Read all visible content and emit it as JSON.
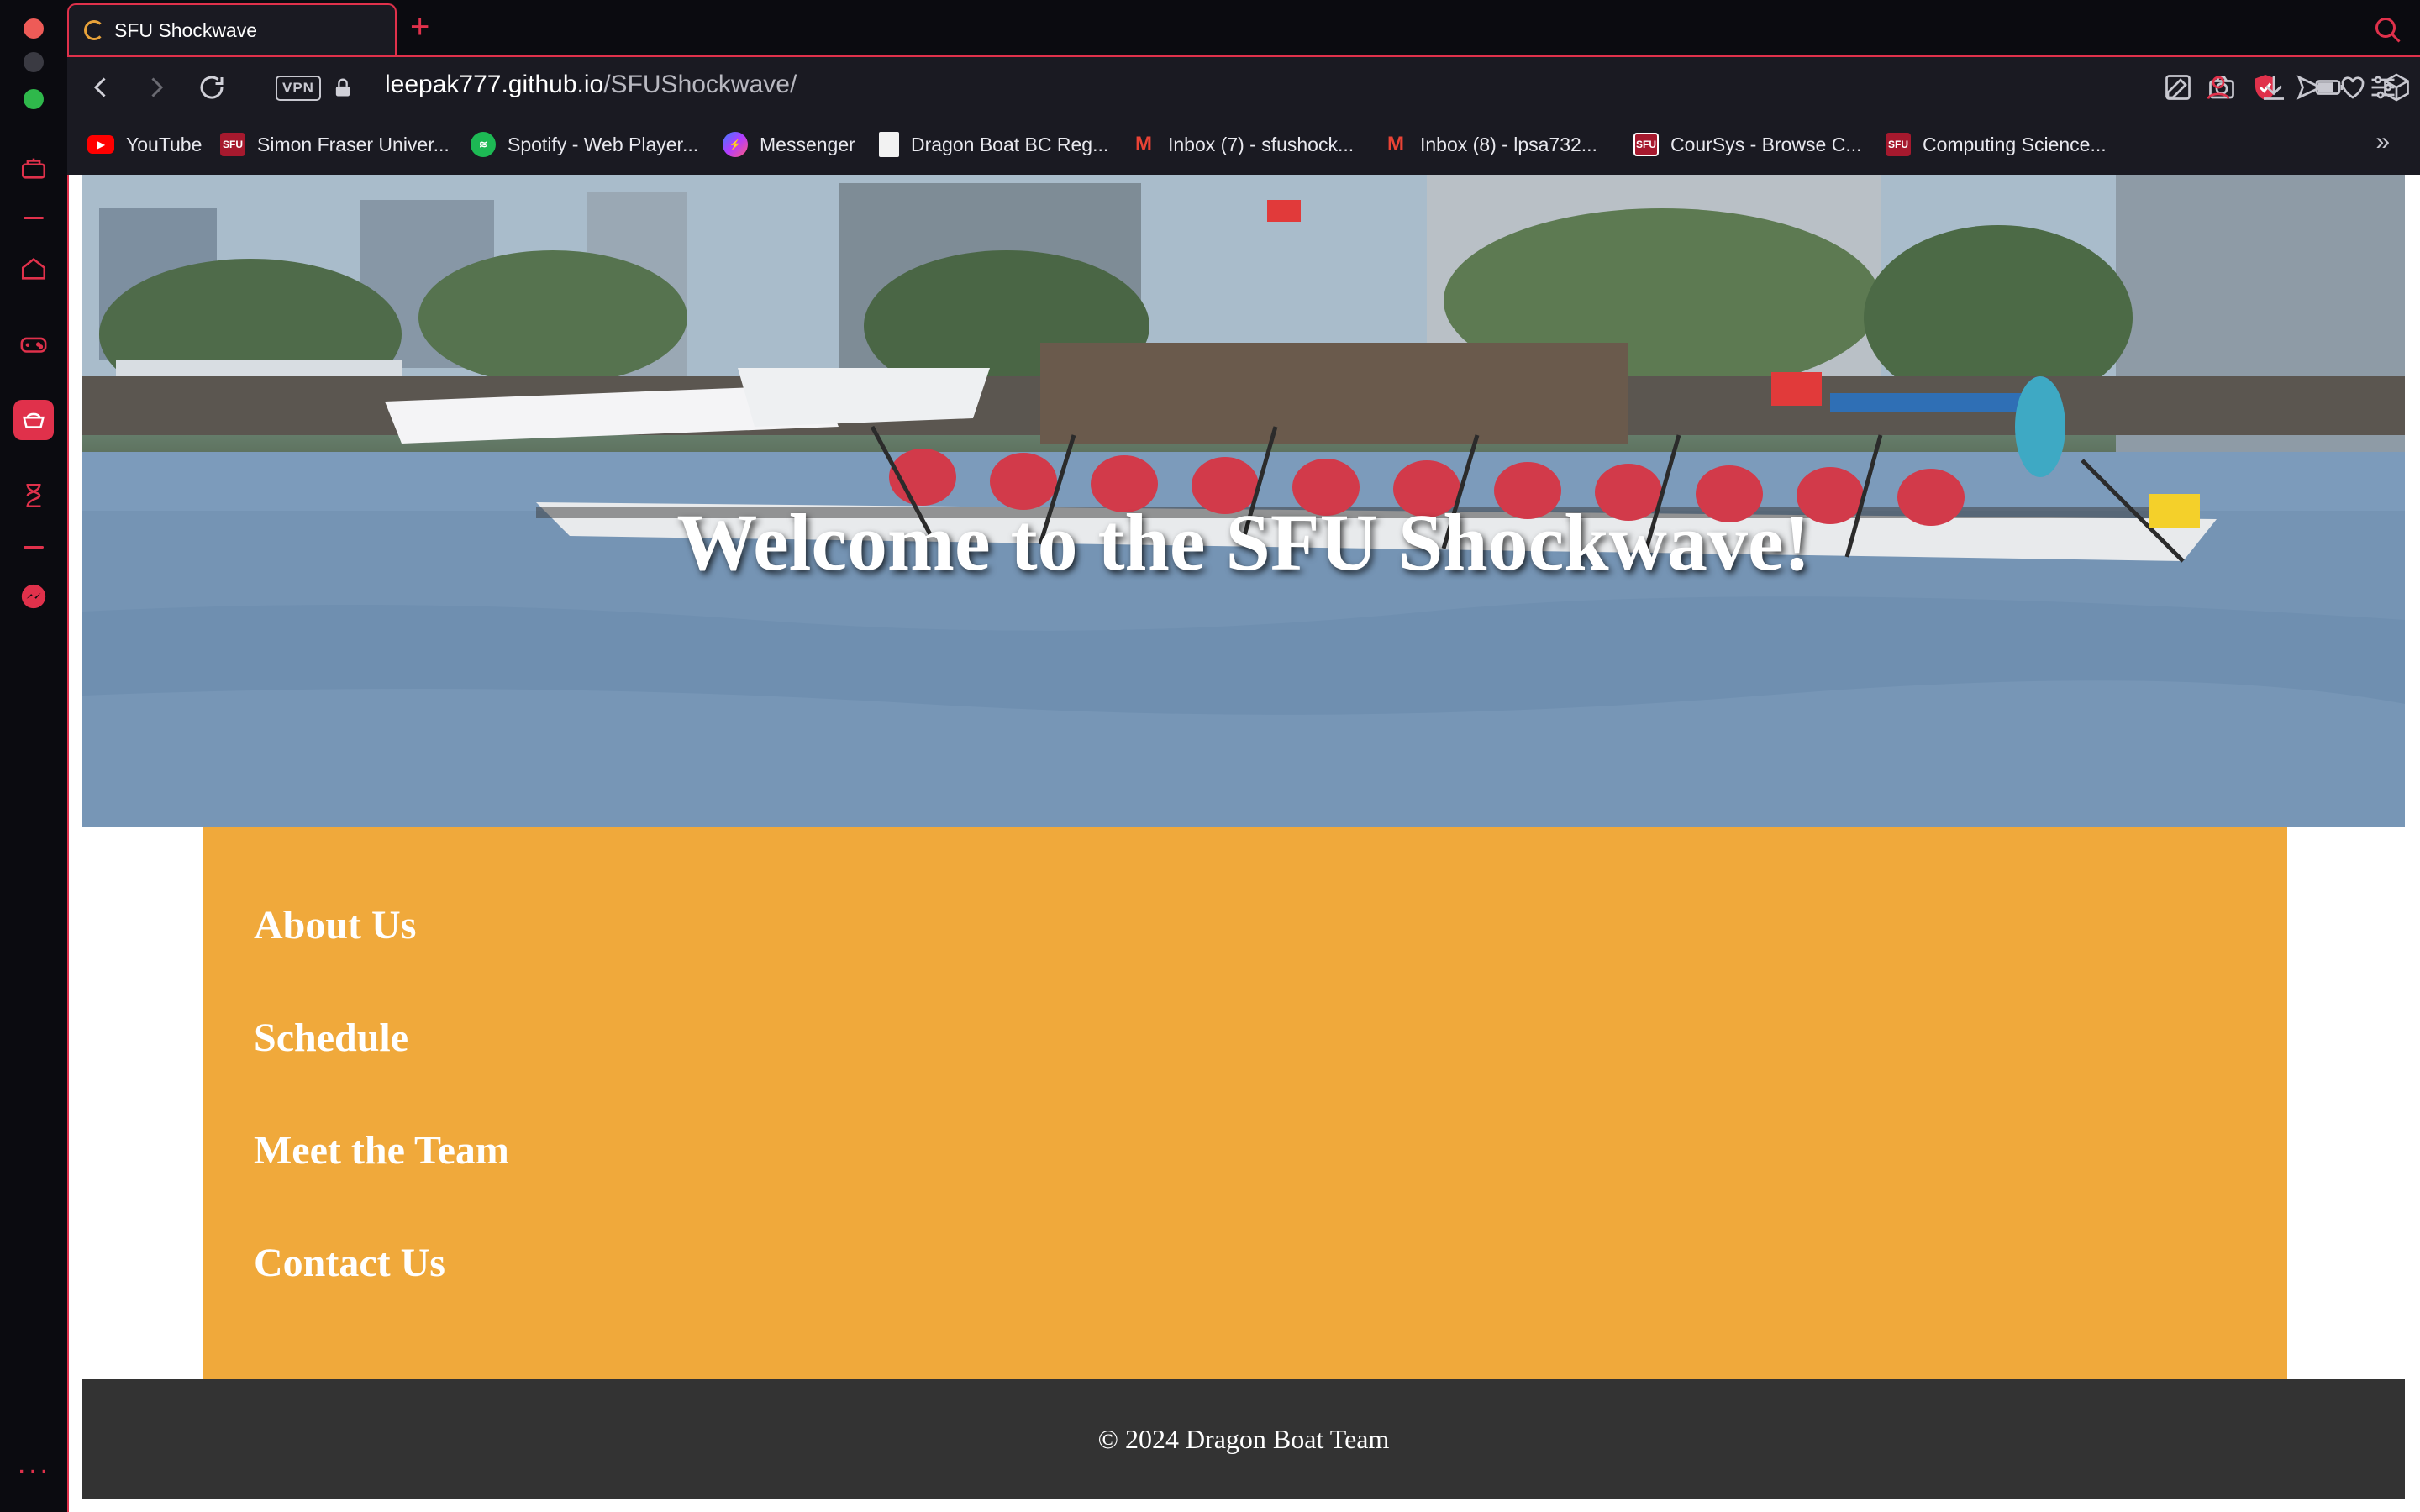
{
  "browser": {
    "tab_title": "SFU Shockwave",
    "new_tab_glyph": "+",
    "vpn_label": "VPN",
    "url_host": "leepak777.github.io",
    "url_path": "/SFUShockwave/",
    "accent_color": "#e0314b"
  },
  "bookmarks": [
    {
      "label": "YouTube",
      "icon": "youtube-icon"
    },
    {
      "label": "Simon Fraser Univer...",
      "icon": "sfu-icon"
    },
    {
      "label": "Spotify - Web Player...",
      "icon": "spotify-icon"
    },
    {
      "label": "Messenger",
      "icon": "messenger-icon"
    },
    {
      "label": "Dragon Boat BC Reg...",
      "icon": "document-icon"
    },
    {
      "label": "Inbox (7) - sfushock...",
      "icon": "gmail-icon"
    },
    {
      "label": "Inbox (8) - lpsa732...",
      "icon": "gmail-icon"
    },
    {
      "label": "CourSys - Browse C...",
      "icon": "sfu-icon"
    },
    {
      "label": "Computing Science...",
      "icon": "sfu-icon"
    }
  ],
  "bookmarks_more": "»",
  "page": {
    "hero_title": "Welcome to the SFU Shockwave!",
    "nav": [
      "About Us",
      "Schedule",
      "Meet the Team",
      "Contact Us"
    ],
    "footer": "© 2024 Dragon Boat Team",
    "nav_bg": "#f0a93b",
    "footer_bg": "#333333"
  }
}
